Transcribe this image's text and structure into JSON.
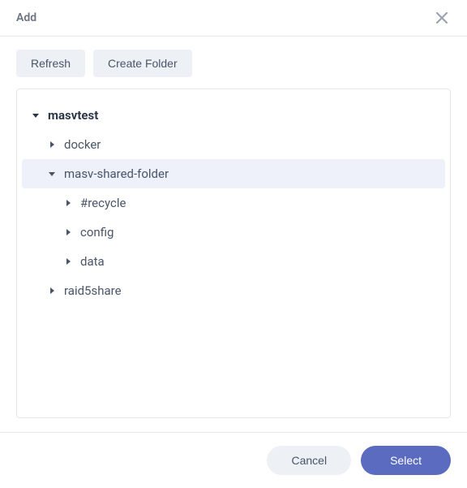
{
  "dialog": {
    "title": "Add"
  },
  "toolbar": {
    "refresh_label": "Refresh",
    "create_folder_label": "Create Folder"
  },
  "tree": {
    "nodes": [
      {
        "label": "masvtest",
        "level": 0,
        "expanded": true,
        "root": true,
        "selected": false
      },
      {
        "label": "docker",
        "level": 1,
        "expanded": false,
        "root": false,
        "selected": false
      },
      {
        "label": "masv-shared-folder",
        "level": 1,
        "expanded": true,
        "root": false,
        "selected": true
      },
      {
        "label": "#recycle",
        "level": 2,
        "expanded": false,
        "root": false,
        "selected": false
      },
      {
        "label": "config",
        "level": 2,
        "expanded": false,
        "root": false,
        "selected": false
      },
      {
        "label": "data",
        "level": 2,
        "expanded": false,
        "root": false,
        "selected": false
      },
      {
        "label": "raid5share",
        "level": 1,
        "expanded": false,
        "root": false,
        "selected": false
      }
    ]
  },
  "footer": {
    "cancel_label": "Cancel",
    "select_label": "Select"
  }
}
